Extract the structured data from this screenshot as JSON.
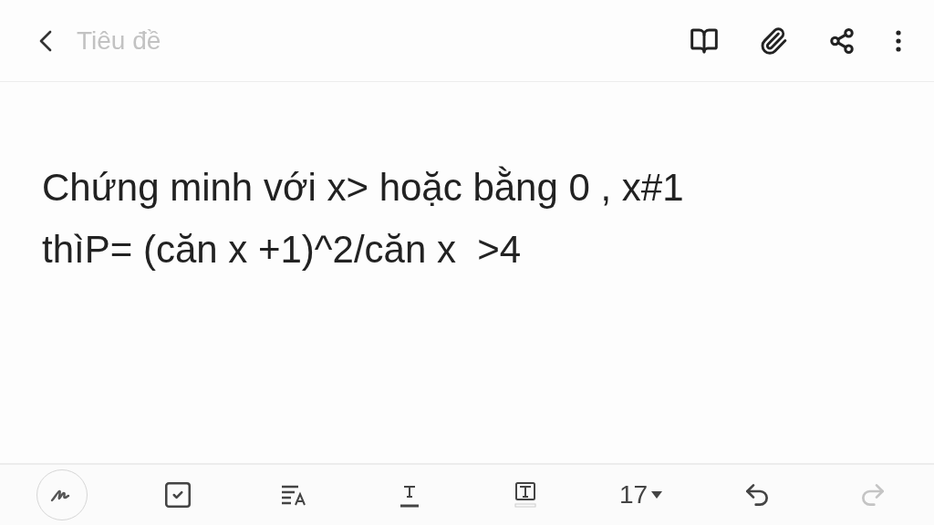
{
  "title_field": {
    "placeholder": "Tiêu đề"
  },
  "body": {
    "text": "Chứng minh với x> hoặc bằng 0 , x#1\nthìP= (căn x +1)^2/căn x  >4"
  },
  "toolbar": [
    {
      "kind": "pen",
      "selected": false
    },
    {
      "kind": "checkbox"
    },
    {
      "kind": "paragraph"
    },
    {
      "kind": "text-color"
    },
    {
      "kind": "highlight"
    },
    {
      "kind": "font-size",
      "label": "17"
    },
    {
      "kind": "undo",
      "disabled": false
    },
    {
      "kind": "redo",
      "disabled": true
    }
  ]
}
